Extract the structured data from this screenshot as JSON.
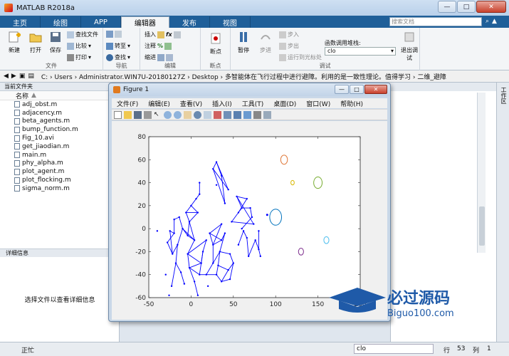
{
  "window": {
    "title": "MATLAB R2018a",
    "min": "—",
    "max": "□",
    "close": "✕"
  },
  "tabs": [
    "主页",
    "绘图",
    "APP",
    "编辑器",
    "发布",
    "视图"
  ],
  "search_placeholder": "搜索文档",
  "toolstrip": {
    "file": {
      "label": "文件",
      "new": "新建",
      "open": "打开",
      "save": "保存",
      "find_files": "查找文件",
      "compare": "比较",
      "print": "打印"
    },
    "nav": {
      "label": "导航",
      "goto": "转至",
      "find": "查找"
    },
    "edit": {
      "label": "编辑",
      "insert": "插入",
      "comment": "注释",
      "indent": "缩进"
    },
    "breakpoints": {
      "label": "断点",
      "breakpoint": "断点"
    },
    "run": {
      "label": "调试",
      "pause": "暂停",
      "step": "步进",
      "step_in": "步入",
      "step_out": "步出",
      "run_to_cursor": "运行到光标处",
      "stack_label": "函数调用堆栈:",
      "stack_value": "clo",
      "quit_debug": "退出调试"
    }
  },
  "addressbar": {
    "path": "C: › Users › Administrator.WIN7U-20180127Z › Desktop › 多智能体在飞行过程中进行避障。利用的是一致性理论。值得学习 › 二维_避障"
  },
  "current_folder": {
    "title": "当前文件夹",
    "column": "名称",
    "files": [
      "adj_obst.m",
      "adjacency.m",
      "beta_agents.m",
      "bump_function.m",
      "Fig_10.avi",
      "get_jiaodian.m",
      "main.m",
      "phy_alpha.m",
      "plot_agent.m",
      "plot_flocking.m",
      "sigma_norm.m"
    ]
  },
  "details": {
    "title": "详细信息",
    "text": "选择文件以查看详细信息"
  },
  "right_strip_label": "工作区",
  "status": {
    "ready": "正忙",
    "function": "clo",
    "row_label": "行",
    "row": "53",
    "col_label": "列",
    "col": "1"
  },
  "figure": {
    "title": "Figure 1",
    "menu": [
      "文件(F)",
      "编辑(E)",
      "查看(V)",
      "插入(I)",
      "工具(T)",
      "桌面(D)",
      "窗口(W)",
      "帮助(H)"
    ]
  },
  "chart_data": {
    "type": "scatter",
    "title": "",
    "xlabel": "",
    "ylabel": "",
    "xlim": [
      -50,
      200
    ],
    "ylim": [
      -60,
      80
    ],
    "xticks": [
      -50,
      0,
      50,
      100,
      150,
      200
    ],
    "yticks": [
      -60,
      -40,
      -20,
      0,
      20,
      40,
      60,
      80
    ],
    "agent_color": "#0000ff",
    "agents": [
      [
        -23,
        -50
      ],
      [
        -18,
        -30
      ],
      [
        -12,
        -38
      ],
      [
        -8,
        -48
      ],
      [
        -16,
        -14
      ],
      [
        -22,
        -22
      ],
      [
        -28,
        -12
      ],
      [
        -20,
        -4
      ],
      [
        -25,
        -2
      ],
      [
        -20,
        8
      ],
      [
        -14,
        10
      ],
      [
        -10,
        0
      ],
      [
        -4,
        -6
      ],
      [
        -2,
        6
      ],
      [
        -6,
        14
      ],
      [
        0,
        20
      ],
      [
        6,
        26
      ],
      [
        10,
        30
      ],
      [
        10,
        40
      ],
      [
        8,
        14
      ],
      [
        4,
        -10
      ],
      [
        -4,
        -22
      ],
      [
        -2,
        -34
      ],
      [
        4,
        -46
      ],
      [
        8,
        -58
      ],
      [
        18,
        -40
      ],
      [
        26,
        -30
      ],
      [
        26,
        -14
      ],
      [
        22,
        -4
      ],
      [
        34,
        -20
      ],
      [
        40,
        -4
      ],
      [
        36,
        -10
      ],
      [
        46,
        -22
      ],
      [
        50,
        -30
      ],
      [
        44,
        -36
      ],
      [
        36,
        -46
      ],
      [
        30,
        -40
      ],
      [
        20,
        -50
      ],
      [
        32,
        -32
      ],
      [
        46,
        -44
      ],
      [
        56,
        -14
      ],
      [
        62,
        -2
      ],
      [
        66,
        -8
      ],
      [
        48,
        6
      ],
      [
        56,
        14
      ],
      [
        66,
        26
      ],
      [
        54,
        28
      ],
      [
        60,
        18
      ],
      [
        70,
        18
      ],
      [
        72,
        10
      ],
      [
        60,
        0
      ],
      [
        68,
        -24
      ],
      [
        76,
        -10
      ],
      [
        80,
        -18
      ],
      [
        80,
        -2
      ],
      [
        82,
        -24
      ],
      [
        -40,
        -2
      ],
      [
        -26,
        -58
      ],
      [
        -30,
        -40
      ],
      [
        30,
        38
      ],
      [
        40,
        22
      ],
      [
        26,
        52
      ],
      [
        30,
        58
      ],
      [
        36,
        46
      ],
      [
        44,
        34
      ],
      [
        12,
        -30
      ],
      [
        10,
        -40
      ],
      [
        14,
        -20
      ],
      [
        18,
        -10
      ],
      [
        36,
        4
      ],
      [
        74,
        4
      ]
    ],
    "edges": [
      [
        0,
        1
      ],
      [
        1,
        2
      ],
      [
        2,
        3
      ],
      [
        1,
        4
      ],
      [
        4,
        5
      ],
      [
        5,
        6
      ],
      [
        6,
        7
      ],
      [
        7,
        8
      ],
      [
        7,
        9
      ],
      [
        9,
        10
      ],
      [
        10,
        11
      ],
      [
        11,
        12
      ],
      [
        12,
        13
      ],
      [
        13,
        14
      ],
      [
        14,
        15
      ],
      [
        15,
        16
      ],
      [
        16,
        17
      ],
      [
        17,
        18
      ],
      [
        15,
        19
      ],
      [
        19,
        13
      ],
      [
        13,
        20
      ],
      [
        20,
        12
      ],
      [
        20,
        21
      ],
      [
        21,
        22
      ],
      [
        22,
        23
      ],
      [
        23,
        24
      ],
      [
        4,
        11
      ],
      [
        11,
        20
      ],
      [
        14,
        19
      ],
      [
        25,
        26
      ],
      [
        26,
        27
      ],
      [
        27,
        28
      ],
      [
        26,
        29
      ],
      [
        29,
        30
      ],
      [
        30,
        31
      ],
      [
        31,
        27
      ],
      [
        29,
        32
      ],
      [
        32,
        33
      ],
      [
        33,
        34
      ],
      [
        34,
        35
      ],
      [
        35,
        36
      ],
      [
        36,
        25
      ],
      [
        29,
        38
      ],
      [
        38,
        34
      ],
      [
        33,
        39
      ],
      [
        39,
        35
      ],
      [
        38,
        36
      ],
      [
        31,
        28
      ],
      [
        43,
        44
      ],
      [
        44,
        45
      ],
      [
        45,
        46
      ],
      [
        46,
        47
      ],
      [
        47,
        48
      ],
      [
        48,
        49
      ],
      [
        49,
        50
      ],
      [
        44,
        47
      ],
      [
        40,
        41
      ],
      [
        41,
        42
      ],
      [
        42,
        51
      ],
      [
        51,
        52
      ],
      [
        52,
        53
      ],
      [
        53,
        54
      ],
      [
        53,
        55
      ],
      [
        60,
        61
      ],
      [
        61,
        62
      ],
      [
        62,
        63
      ],
      [
        63,
        60
      ],
      [
        62,
        64
      ],
      [
        64,
        61
      ],
      [
        25,
        66
      ],
      [
        66,
        67
      ],
      [
        67,
        65
      ],
      [
        65,
        22
      ],
      [
        67,
        68
      ],
      [
        68,
        21
      ],
      [
        27,
        69
      ],
      [
        69,
        28
      ],
      [
        21,
        65
      ],
      [
        22,
        66
      ],
      [
        43,
        70
      ],
      [
        46,
        70
      ],
      [
        8,
        5
      ]
    ],
    "obstacles": [
      {
        "x": 110,
        "y": 60,
        "r": 4,
        "color": "#e0793a"
      },
      {
        "x": 120,
        "y": 40,
        "r": 2,
        "color": "#d8b800"
      },
      {
        "x": 150,
        "y": 40,
        "r": 5,
        "color": "#77ac30"
      },
      {
        "x": 100,
        "y": 10,
        "r": 7,
        "color": "#0072bd"
      },
      {
        "x": 160,
        "y": -10,
        "r": 3,
        "color": "#4dbeee"
      },
      {
        "x": 130,
        "y": -20,
        "r": 3,
        "color": "#7e2f8e"
      }
    ],
    "special_points": [
      {
        "x": 90,
        "y": 12,
        "color": "#0000ff"
      }
    ]
  },
  "watermark": {
    "brand": "必过源码",
    "site": "Biguo100.com"
  }
}
